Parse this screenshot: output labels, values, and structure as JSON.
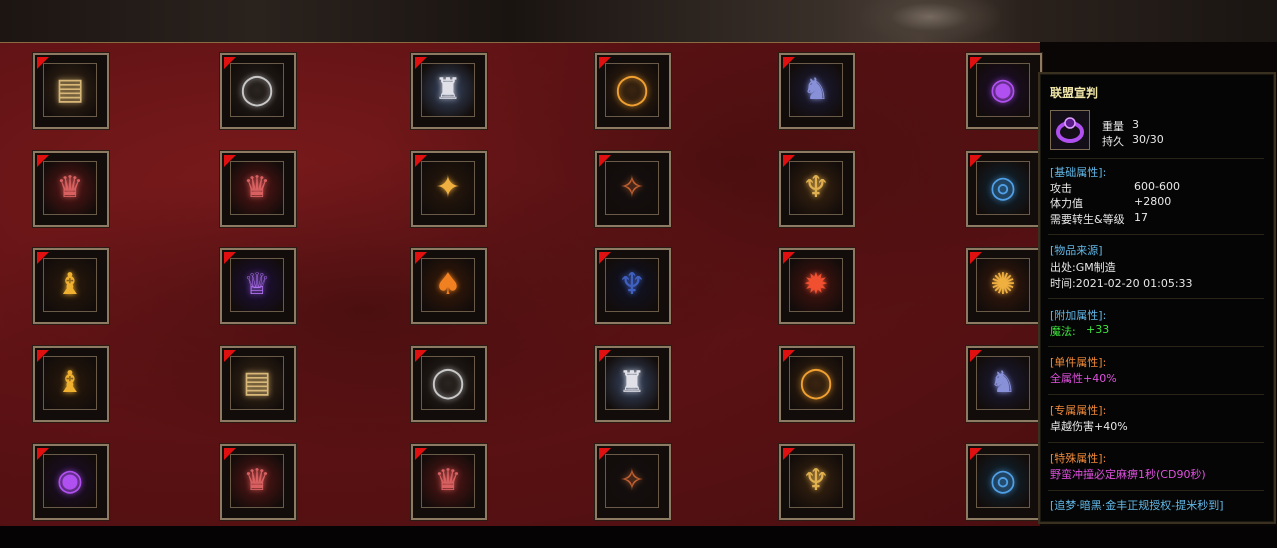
{
  "grid": {
    "rows": [
      [
        {
          "icon": "scroll-icon",
          "glyph": "▤",
          "color": "#d8b878",
          "bg": "#3a2a18"
        },
        {
          "icon": "silver-ring-icon",
          "glyph": "◯",
          "color": "#c8c8c8",
          "bg": "#2a2420"
        },
        {
          "icon": "white-haired-character-icon",
          "glyph": "♜",
          "color": "#e0e0e8",
          "bg": "#3a4a68"
        },
        {
          "icon": "gold-ring-icon",
          "glyph": "◯",
          "color": "#f0a030",
          "bg": "#3a2410"
        },
        {
          "icon": "dark-helmet-icon",
          "glyph": "♞",
          "color": "#8890d8",
          "bg": "#1c1c3a"
        },
        {
          "icon": "purple-ring-icon",
          "glyph": "◉",
          "color": "#b050f0",
          "bg": "#1e0e30"
        }
      ],
      [
        {
          "icon": "red-armor-icon",
          "glyph": "♛",
          "color": "#d86060",
          "bg": "#5a1616"
        },
        {
          "icon": "red-armor-icon",
          "glyph": "♛",
          "color": "#d86060",
          "bg": "#5a1616"
        },
        {
          "icon": "gold-ornament-icon",
          "glyph": "✦",
          "color": "#f0b040",
          "bg": "#2a1a0c"
        },
        {
          "icon": "spark-icon",
          "glyph": "✧",
          "color": "#c06030",
          "bg": "#141010"
        },
        {
          "icon": "gold-wings-icon",
          "glyph": "♆",
          "color": "#e0b050",
          "bg": "#3a2410"
        },
        {
          "icon": "blue-eye-amulet-icon",
          "glyph": "◎",
          "color": "#50a0e8",
          "bg": "#102838"
        }
      ],
      [
        {
          "icon": "gold-charm-icon",
          "glyph": "♝",
          "color": "#f0b030",
          "bg": "#2a1a0c"
        },
        {
          "icon": "purple-crown-icon",
          "glyph": "♕",
          "color": "#b070f0",
          "bg": "#1e1040"
        },
        {
          "icon": "gold-boots-icon",
          "glyph": "♠",
          "color": "#f08020",
          "bg": "#3a1a08"
        },
        {
          "icon": "blue-wings-icon",
          "glyph": "♆",
          "color": "#4060c0",
          "bg": "#101428"
        },
        {
          "icon": "fire-orb-icon",
          "glyph": "✹",
          "color": "#f05030",
          "bg": "#4a1410"
        },
        {
          "icon": "gold-cluster-icon",
          "glyph": "✺",
          "color": "#f0b040",
          "bg": "#3a1a0c"
        }
      ],
      [
        {
          "icon": "gold-charm-icon",
          "glyph": "♝",
          "color": "#f0b030",
          "bg": "#2a1a0c"
        },
        {
          "icon": "scroll-icon",
          "glyph": "▤",
          "color": "#d8b878",
          "bg": "#3a2a18"
        },
        {
          "icon": "silver-ring-icon",
          "glyph": "◯",
          "color": "#c8c8c8",
          "bg": "#2a2420"
        },
        {
          "icon": "white-haired-character-icon",
          "glyph": "♜",
          "color": "#e0e0e8",
          "bg": "#3a4a68"
        },
        {
          "icon": "gold-ring-icon",
          "glyph": "◯",
          "color": "#f0a030",
          "bg": "#3a2410"
        },
        {
          "icon": "dark-helmet-icon",
          "glyph": "♞",
          "color": "#8890d8",
          "bg": "#1c1c3a"
        }
      ],
      [
        {
          "icon": "purple-ring-icon",
          "glyph": "◉",
          "color": "#b050f0",
          "bg": "#1e0e30"
        },
        {
          "icon": "red-armor-icon",
          "glyph": "♛",
          "color": "#d86060",
          "bg": "#5a1616"
        },
        {
          "icon": "red-armor-icon",
          "glyph": "♛",
          "color": "#d86060",
          "bg": "#5a1616"
        },
        {
          "icon": "spark-icon",
          "glyph": "✧",
          "color": "#c06030",
          "bg": "#141010"
        },
        {
          "icon": "gold-wings-icon",
          "glyph": "♆",
          "color": "#e0b050",
          "bg": "#3a2410"
        },
        {
          "icon": "blue-eye-amulet-icon",
          "glyph": "◎",
          "color": "#50a0e8",
          "bg": "#102838"
        }
      ]
    ]
  },
  "tooltip": {
    "title": "联盟宣判",
    "icon": "purple-ring-icon",
    "weight_label": "重量",
    "weight_value": "3",
    "durability_label": "持久",
    "durability_value": "30/30",
    "base_header": "[基础属性]:",
    "attack_label": "攻击",
    "attack_value": "600-600",
    "hp_label": "体力值",
    "hp_value": "+2800",
    "req_label": "需要转生&等级",
    "req_value": "17",
    "source_header": "[物品来源]",
    "origin": "出处:GM制造",
    "time": "时间:2021-02-20 01:05:33",
    "extra_header": "[附加属性]:",
    "magic_label": "魔法:",
    "magic_value": "+33",
    "single_header": "[单件属性]:",
    "single_value": "全属性+40%",
    "exclusive_header": "[专属属性]:",
    "exclusive_value": "卓越伤害+40%",
    "special_header": "[特殊属性]:",
    "special_value": "野蛮冲撞必定麻痹1秒(CD90秒)",
    "footer": "[追梦·暗黑·金丰正规授权-提米秒到]"
  }
}
